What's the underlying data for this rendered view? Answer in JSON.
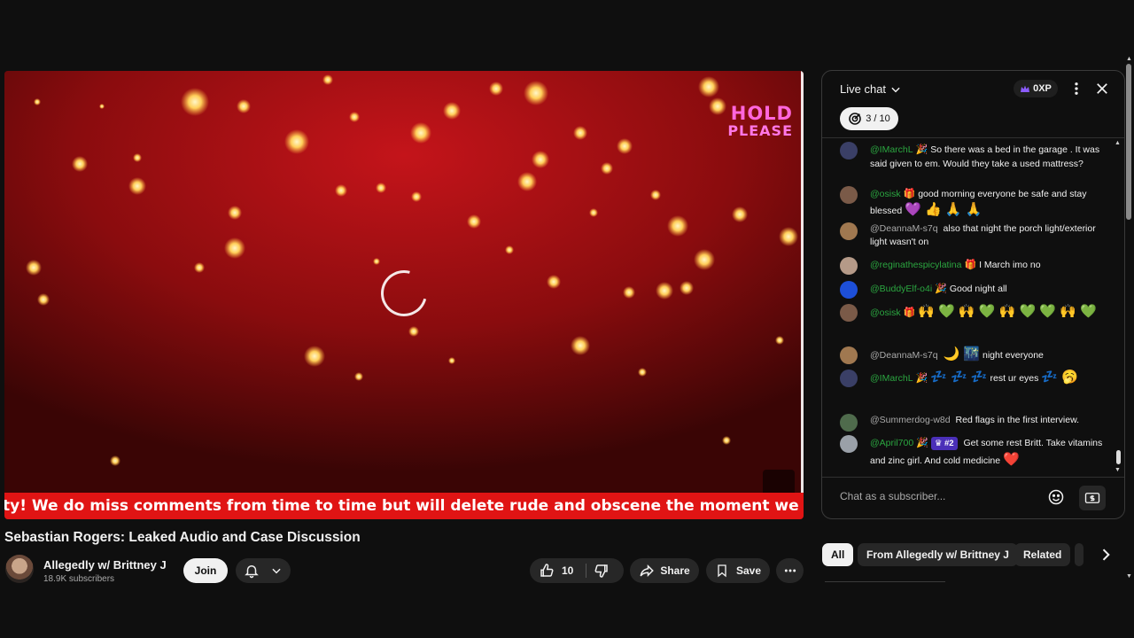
{
  "video": {
    "overlay_line1": "HOLD",
    "overlay_line2": "PLEASE",
    "ticker": "ty! We do miss comments from time to time but will delete rude and obscene the moment we are m",
    "title": "Sebastian Rogers: Leaked Audio and Case Discussion"
  },
  "channel": {
    "name": "Allegedly w/ Brittney J",
    "subscribers": "18.9K subscribers",
    "join_label": "Join"
  },
  "actions": {
    "likes": "10",
    "share_label": "Share",
    "save_label": "Save"
  },
  "chat": {
    "title": "Live chat",
    "xp": "0XP",
    "goal": "3 / 10",
    "input_placeholder": "Chat as a subscriber...",
    "messages": [
      {
        "author": "@IMarchL",
        "emoji_after_name": "🎉",
        "text": "So there was a bed in the garage . It was said given to em. Would they take a used mattress?",
        "author_color": "#2ba640",
        "avatar_color": "#3a3f66"
      },
      {
        "author": "@osisk",
        "emoji_after_name": "🎁",
        "text": "good morning everyone be safe and stay blessed",
        "emojis": "💜 👍 🙏 🙏",
        "author_color": "#2ba640",
        "avatar_color": "#7a5a48"
      },
      {
        "author": "@DeannaM-s7q",
        "text": "also that night the porch light/exterior light wasn't on",
        "author_color": "#aaaaaa",
        "avatar_color": "#a07850"
      },
      {
        "author": "@reginathespicylatina",
        "emoji_after_name": "🎁",
        "text": "I March imo no",
        "author_color": "#2ba640",
        "avatar_color": "#b59a88"
      },
      {
        "author": "@BuddyElf-o4i",
        "emoji_after_name": "🎉",
        "text": "Good night all",
        "author_color": "#2ba640",
        "avatar_color": "#1d4fd8"
      },
      {
        "author": "@osisk",
        "emoji_after_name": "🎁",
        "emojis": "🙌 💚 🙌 💚 🙌 💚 💚 🙌 💚",
        "author_color": "#2ba640",
        "avatar_color": "#7a5a48"
      },
      {
        "author": "@DeannaM-s7q",
        "emojis": "🌙 🌃",
        "text": "night everyone",
        "author_color": "#aaaaaa",
        "avatar_color": "#a07850"
      },
      {
        "author": "@IMarchL",
        "emoji_after_name": "🎉",
        "emojis": "💤 💤 💤",
        "text": "rest ur eyes",
        "emojis_after": "💤 🥱",
        "author_color": "#2ba640",
        "avatar_color": "#3a3f66"
      },
      {
        "author": "@Summerdog-w8d",
        "text": "Red flags in the first interview.",
        "author_color": "#aaaaaa",
        "avatar_color": "#4f6b4c"
      },
      {
        "author": "@April700",
        "emoji_after_name": "🎉",
        "badge": "#2",
        "text": "Get some rest Britt. Take vitamins and zinc girl. And cold medicine",
        "emojis_after": "❤️",
        "author_color": "#2ba640",
        "avatar_color": "#9aa0a8"
      }
    ]
  },
  "filters": {
    "chips": [
      "All",
      "From Allegedly w/ Brittney J",
      "Related"
    ]
  },
  "colors": {
    "ticker": "#e01414",
    "author_member": "#2ba640",
    "badge": "#4a2fb8",
    "overlay": "#ff66dd"
  }
}
